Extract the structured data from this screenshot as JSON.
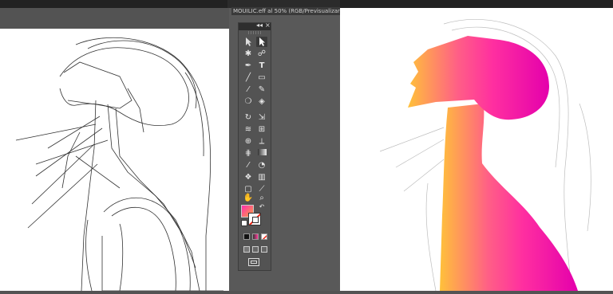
{
  "window": {
    "document_tab_title": "MOUILIC.eff al 50% (RGB/Previsualizar)"
  },
  "colors": {
    "app_dark": "#2b2b2b",
    "panel_gray": "#535353",
    "gradient_start": "#ffb43a",
    "gradient_mid": "#ff2fa0",
    "gradient_end": "#e600a8"
  },
  "toolbox": {
    "collapse_glyph": "◂◂",
    "close_glyph": "×",
    "type_tool_glyph": "T",
    "icons": [
      "selection-tool-icon",
      "direct-selection-tool-icon",
      "magic-wand-tool-icon",
      "lasso-tool-icon",
      "pen-tool-icon",
      "type-tool-icon",
      "line-segment-tool-icon",
      "rectangle-tool-icon",
      "paintbrush-tool-icon",
      "pencil-tool-icon",
      "blob-brush-tool-icon",
      "eraser-tool-icon",
      "rotate-tool-icon",
      "scale-tool-icon",
      "warp-tool-icon",
      "free-transform-tool-icon",
      "shape-builder-tool-icon",
      "perspective-grid-tool-icon",
      "mesh-tool-icon",
      "gradient-tool-icon",
      "eyedropper-tool-icon",
      "blend-tool-icon",
      "symbol-sprayer-tool-icon",
      "column-graph-tool-icon",
      "artboard-tool-icon",
      "slice-tool-icon",
      "hand-tool-icon",
      "zoom-tool-icon"
    ]
  }
}
